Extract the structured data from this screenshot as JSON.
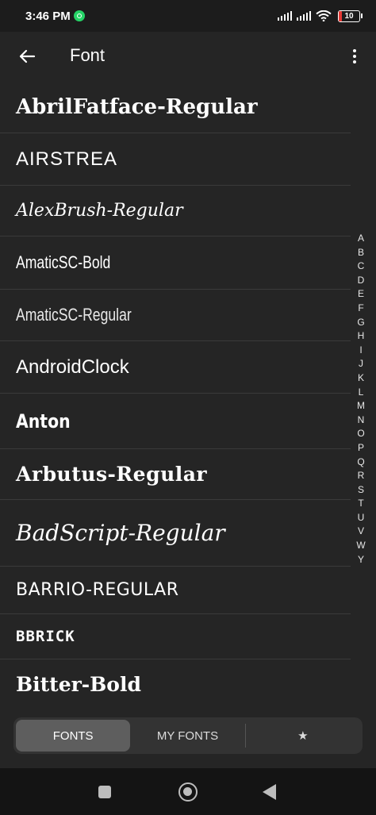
{
  "status_bar": {
    "time": "3:46 PM",
    "battery": "10",
    "icons": [
      "whatsapp-icon",
      "signal-icon",
      "signal-icon",
      "wifi-icon",
      "battery-icon"
    ]
  },
  "app_bar": {
    "title": "Font",
    "back_icon": "arrow-left-icon",
    "menu_icon": "more-vertical-icon"
  },
  "fonts": [
    "AbrilFatface-Regular",
    "AIRSTREA",
    "AlexBrush-Regular",
    "AmaticSC-Bold",
    "AmaticSC-Regular",
    "AndroidClock",
    "Anton",
    "Arbutus-Regular",
    "BadScript-Regular",
    "BARRIO-REGULAR",
    "BBRICK",
    "Bitter-Bold"
  ],
  "alphabet": [
    "A",
    "B",
    "C",
    "D",
    "E",
    "F",
    "G",
    "H",
    "I",
    "J",
    "K",
    "L",
    "M",
    "N",
    "O",
    "P",
    "Q",
    "R",
    "S",
    "T",
    "U",
    "V",
    "W",
    "Y"
  ],
  "tabs": {
    "fonts": "FONTS",
    "my_fonts": "MY FONTS",
    "favorites": "★",
    "active": "fonts"
  },
  "nav_bar": {
    "icons": [
      "recents-square-icon",
      "home-circle-icon",
      "back-triangle-icon"
    ]
  }
}
